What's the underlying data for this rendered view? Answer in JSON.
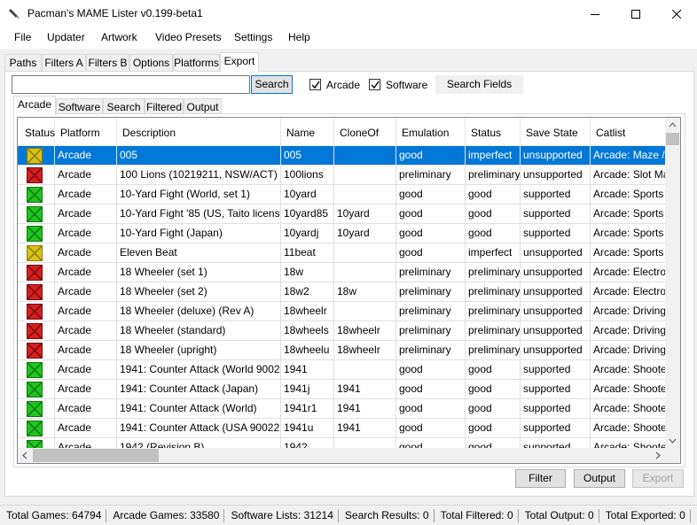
{
  "window": {
    "title": "Pacman's MAME Lister v0.199-beta1"
  },
  "menu": [
    "File",
    "Updater",
    "Artwork",
    "Video Presets",
    "Settings",
    "Help"
  ],
  "main_tabs": [
    "Paths",
    "Filters A",
    "Filters B",
    "Options",
    "Platforms",
    "Export"
  ],
  "main_tabs_active": "Export",
  "toolbar": {
    "search_value": "",
    "search_button": "Search",
    "arcade_label": "Arcade",
    "arcade_checked": true,
    "software_label": "Software",
    "software_checked": true,
    "search_fields_button": "Search Fields"
  },
  "sub_tabs": [
    "Arcade",
    "Software",
    "Search",
    "Filtered",
    "Output"
  ],
  "sub_tabs_active": "Arcade",
  "grid": {
    "columns": [
      "Status",
      "Platform",
      "Description",
      "Name",
      "CloneOf",
      "Emulation",
      "Status",
      "Save State",
      "Catlist"
    ],
    "rows": [
      {
        "status_color": "yellow",
        "platform": "Arcade",
        "description": "005",
        "name": "005",
        "cloneof": "",
        "emulation": "good",
        "status": "imperfect",
        "savestate": "unsupported",
        "catlist": "Arcade: Maze / S",
        "selected": true
      },
      {
        "status_color": "red",
        "platform": "Arcade",
        "description": "100 Lions (10219211, NSW/ACT)",
        "name": "100lions",
        "cloneof": "",
        "emulation": "preliminary",
        "status": "preliminary",
        "savestate": "unsupported",
        "catlist": "Arcade: Slot Mac"
      },
      {
        "status_color": "green",
        "platform": "Arcade",
        "description": "10-Yard Fight (World, set 1)",
        "name": "10yard",
        "cloneof": "",
        "emulation": "good",
        "status": "good",
        "savestate": "supported",
        "catlist": "Arcade: Sports /"
      },
      {
        "status_color": "green",
        "platform": "Arcade",
        "description": "10-Yard Fight '85 (US, Taito license)",
        "name": "10yard85",
        "cloneof": "10yard",
        "emulation": "good",
        "status": "good",
        "savestate": "supported",
        "catlist": "Arcade: Sports /"
      },
      {
        "status_color": "green",
        "platform": "Arcade",
        "description": "10-Yard Fight (Japan)",
        "name": "10yardj",
        "cloneof": "10yard",
        "emulation": "good",
        "status": "good",
        "savestate": "supported",
        "catlist": "Arcade: Sports /"
      },
      {
        "status_color": "yellow",
        "platform": "Arcade",
        "description": "Eleven Beat",
        "name": "11beat",
        "cloneof": "",
        "emulation": "good",
        "status": "imperfect",
        "savestate": "unsupported",
        "catlist": "Arcade: Sports /"
      },
      {
        "status_color": "red",
        "platform": "Arcade",
        "description": "18 Wheeler (set 1)",
        "name": "18w",
        "cloneof": "",
        "emulation": "preliminary",
        "status": "preliminary",
        "savestate": "unsupported",
        "catlist": "Arcade: Electrom"
      },
      {
        "status_color": "red",
        "platform": "Arcade",
        "description": "18 Wheeler (set 2)",
        "name": "18w2",
        "cloneof": "18w",
        "emulation": "preliminary",
        "status": "preliminary",
        "savestate": "unsupported",
        "catlist": "Arcade: Electrom"
      },
      {
        "status_color": "red",
        "platform": "Arcade",
        "description": "18 Wheeler (deluxe) (Rev A)",
        "name": "18wheelr",
        "cloneof": "",
        "emulation": "preliminary",
        "status": "preliminary",
        "savestate": "unsupported",
        "catlist": "Arcade: Driving /"
      },
      {
        "status_color": "red",
        "platform": "Arcade",
        "description": "18 Wheeler (standard)",
        "name": "18wheels",
        "cloneof": "18wheelr",
        "emulation": "preliminary",
        "status": "preliminary",
        "savestate": "unsupported",
        "catlist": "Arcade: Driving /"
      },
      {
        "status_color": "red",
        "platform": "Arcade",
        "description": "18 Wheeler (upright)",
        "name": "18wheelu",
        "cloneof": "18wheelr",
        "emulation": "preliminary",
        "status": "preliminary",
        "savestate": "unsupported",
        "catlist": "Arcade: Driving /"
      },
      {
        "status_color": "green",
        "platform": "Arcade",
        "description": "1941: Counter Attack (World 900227)",
        "name": "1941",
        "cloneof": "",
        "emulation": "good",
        "status": "good",
        "savestate": "supported",
        "catlist": "Arcade: Shooter ."
      },
      {
        "status_color": "green",
        "platform": "Arcade",
        "description": "1941: Counter Attack (Japan)",
        "name": "1941j",
        "cloneof": "1941",
        "emulation": "good",
        "status": "good",
        "savestate": "supported",
        "catlist": "Arcade: Shooter ."
      },
      {
        "status_color": "green",
        "platform": "Arcade",
        "description": "1941: Counter Attack (World)",
        "name": "1941r1",
        "cloneof": "1941",
        "emulation": "good",
        "status": "good",
        "savestate": "supported",
        "catlist": "Arcade: Shooter ."
      },
      {
        "status_color": "green",
        "platform": "Arcade",
        "description": "1941: Counter Attack (USA 900227)",
        "name": "1941u",
        "cloneof": "1941",
        "emulation": "good",
        "status": "good",
        "savestate": "supported",
        "catlist": "Arcade: Shooter ."
      },
      {
        "status_color": "green",
        "platform": "Arcade",
        "description": "1942 (Revision B)",
        "name": "1942",
        "cloneof": "",
        "emulation": "good",
        "status": "good",
        "savestate": "supported",
        "catlist": "Arcade: Shooter ."
      }
    ]
  },
  "buttons": {
    "filter": "Filter",
    "output": "Output",
    "export": "Export"
  },
  "statusbar": [
    "Total Games: 64794",
    "Arcade Games: 33580",
    "Software Lists: 31214",
    "Search Results: 0",
    "Total Filtered: 0",
    "Total Output: 0",
    "Total Exported: 0"
  ],
  "colors": {
    "selection": "#0078d7",
    "status_green": "#22c322",
    "status_yellow": "#d8c21a",
    "status_red": "#d42020"
  }
}
